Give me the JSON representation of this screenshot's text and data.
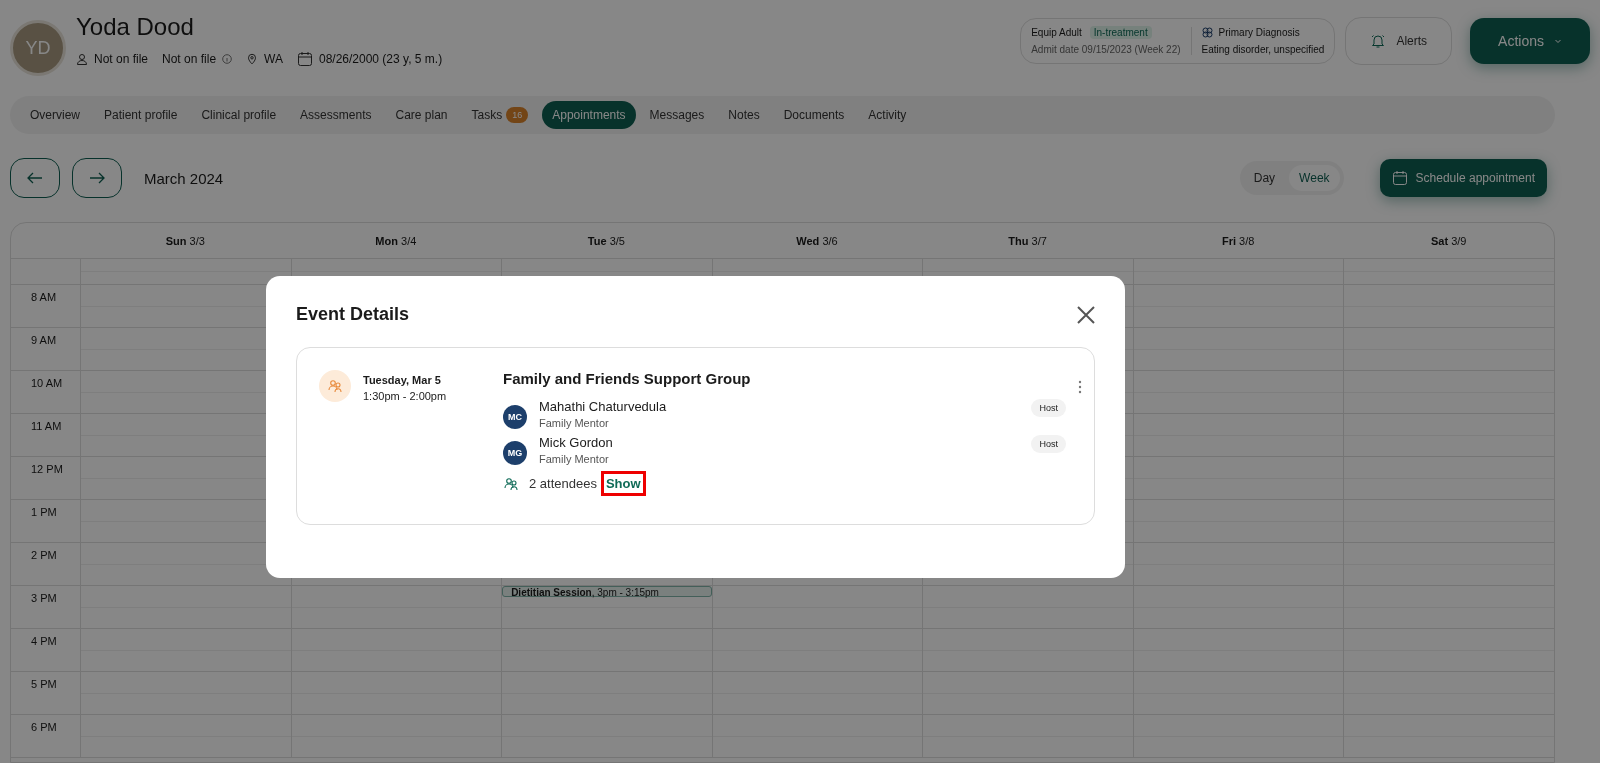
{
  "patient": {
    "initials": "YD",
    "name": "Yoda Dood",
    "gender": "Not on file",
    "pronouns": "Not on file",
    "state": "WA",
    "birth": "08/26/2000 (23 y, 5 m.)"
  },
  "program": {
    "name": "Equip Adult",
    "status": "In-treatment",
    "admit": "Admit date 09/15/2023 (Week 22)",
    "diagnosis_label": "Primary Diagnosis",
    "diagnosis": "Eating disorder, unspecified"
  },
  "alerts_button": "Alerts",
  "actions_button": "Actions",
  "tabs": [
    {
      "label": "Overview",
      "selected": false
    },
    {
      "label": "Patient profile",
      "selected": false
    },
    {
      "label": "Clinical profile",
      "selected": false
    },
    {
      "label": "Assessments",
      "selected": false
    },
    {
      "label": "Care plan",
      "selected": false
    },
    {
      "label": "Tasks",
      "badge": "16",
      "selected": false
    },
    {
      "label": "Appointments",
      "selected": true
    },
    {
      "label": "Messages",
      "selected": false
    },
    {
      "label": "Notes",
      "selected": false
    },
    {
      "label": "Documents",
      "selected": false
    },
    {
      "label": "Activity",
      "selected": false
    }
  ],
  "month": "March 2024",
  "views": [
    {
      "label": "Day",
      "selected": false
    },
    {
      "label": "Week",
      "selected": true
    }
  ],
  "schedule_button": "Schedule appointment",
  "days": [
    {
      "weekday": "Sun",
      "date": "3/3"
    },
    {
      "weekday": "Mon",
      "date": "3/4"
    },
    {
      "weekday": "Tue",
      "date": "3/5"
    },
    {
      "weekday": "Wed",
      "date": "3/6"
    },
    {
      "weekday": "Thu",
      "date": "3/7"
    },
    {
      "weekday": "Fri",
      "date": "3/8"
    },
    {
      "weekday": "Sat",
      "date": "3/9"
    }
  ],
  "hours": [
    "8 AM",
    "9 AM",
    "10 AM",
    "11 AM",
    "12 PM",
    "1 PM",
    "2 PM",
    "3 PM",
    "4 PM",
    "5 PM",
    "6 PM"
  ],
  "events": [
    {
      "text": "**Dietitian Session**, 3pm - 3:15pm"
    }
  ],
  "modal": {
    "title": "Event Details",
    "date": "Tuesday, Mar 5",
    "time": "1:30pm - 2:00pm",
    "event_title": "Family and Friends Support Group",
    "hosts": [
      {
        "initials": "MC",
        "name": "Mahathi Chaturvedula",
        "role": "Family Mentor",
        "badge": "Host"
      },
      {
        "initials": "MG",
        "name": "Mick Gordon",
        "role": "Family Mentor",
        "badge": "Host"
      }
    ],
    "attendees": "2 attendees",
    "show_link": "Show"
  }
}
